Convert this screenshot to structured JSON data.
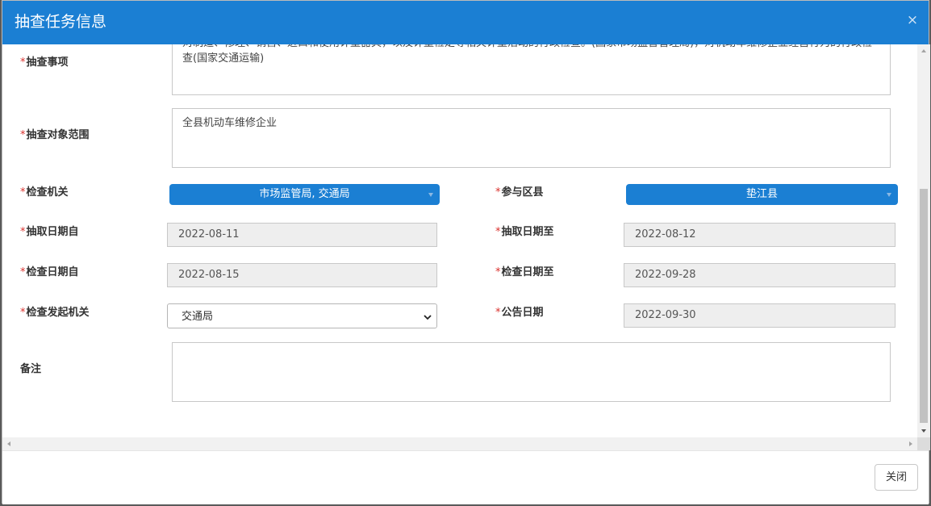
{
  "modal": {
    "title": "抽查任务信息",
    "close_glyph": "×"
  },
  "form": {
    "required_mark": "*",
    "inspection_items": {
      "label": "抽查事项",
      "value": "对制造、修理、销售、进口和使用计量器具，以及计量检定等相关计量活动的行政检查。(国家市场监督管理局)，对机动车维修企业经营行为的行政检查(国家交通运输)"
    },
    "object_scope": {
      "label": "抽查对象范围",
      "value": "全县机动车维修企业"
    },
    "inspection_agency": {
      "label": "检查机关",
      "value": "市场监管局, 交通局"
    },
    "district": {
      "label": "参与区县",
      "value": "垫江县"
    },
    "draw_date_from": {
      "label": "抽取日期自",
      "value": "2022-08-11"
    },
    "draw_date_to": {
      "label": "抽取日期至",
      "value": "2022-08-12"
    },
    "check_date_from": {
      "label": "检查日期自",
      "value": "2022-08-15"
    },
    "check_date_to": {
      "label": "检查日期至",
      "value": "2022-09-28"
    },
    "initiating_agency": {
      "label": "检查发起机关",
      "selected": "交通局"
    },
    "announce_date": {
      "label": "公告日期",
      "value": "2022-09-30"
    },
    "remarks": {
      "label": "备注",
      "value": ""
    }
  },
  "footer": {
    "close_label": "关闭"
  },
  "colors": {
    "header": "#1b7fd3",
    "required": "#d9302c",
    "readonly_bg": "#eeeeee"
  }
}
